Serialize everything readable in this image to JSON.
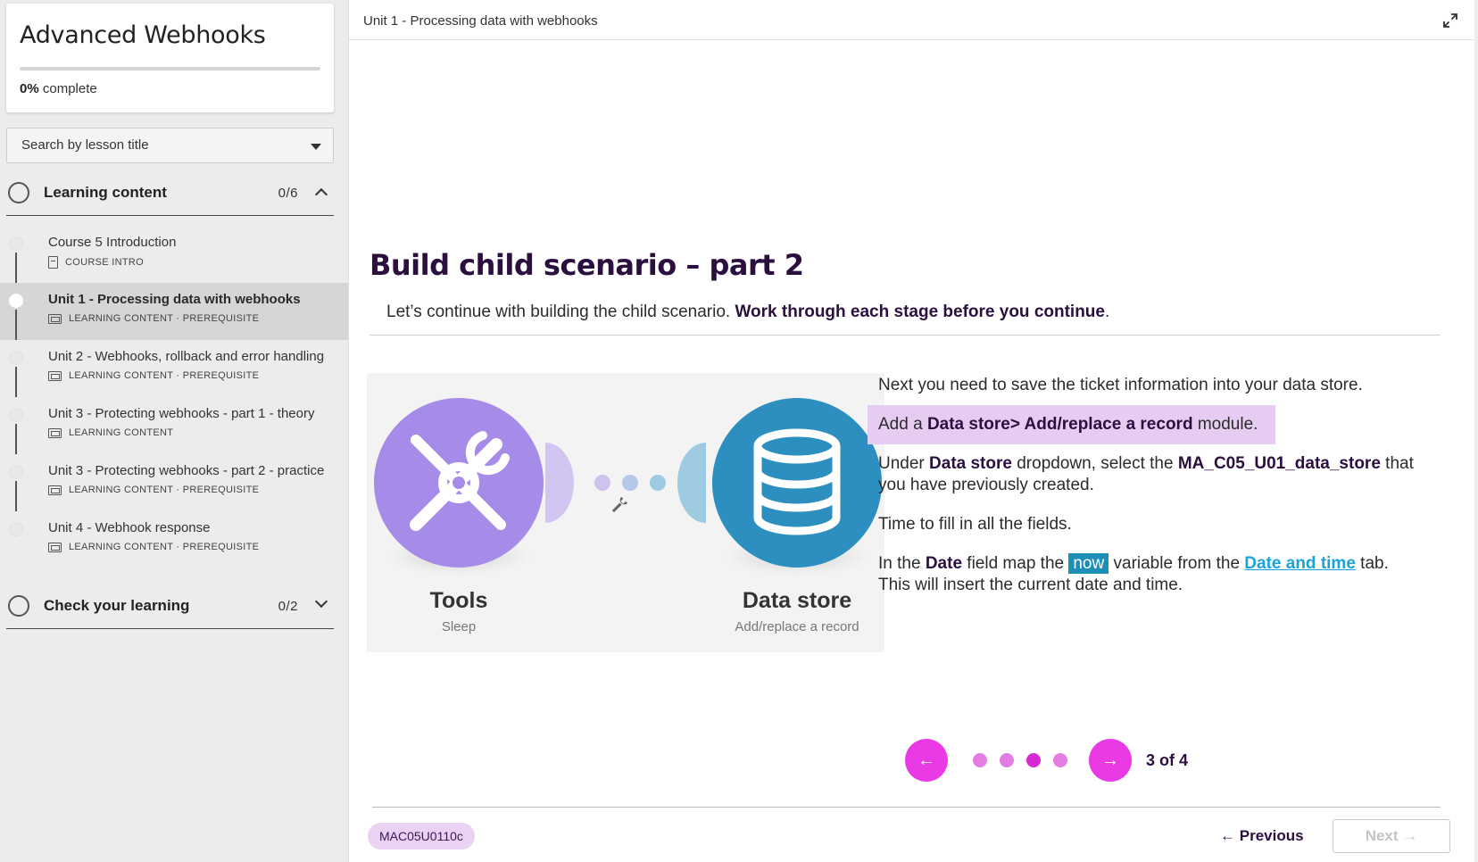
{
  "sidebar": {
    "course_title": "Advanced Webhooks",
    "progress_percent": "0%",
    "progress_suffix": "complete",
    "progress_value": 0,
    "search_placeholder": "Search by lesson title",
    "sections": [
      {
        "label": "Learning content",
        "count": "0/6"
      },
      {
        "label": "Check your learning",
        "count": "0/2"
      }
    ],
    "lessons": [
      {
        "title": "Course 5 Introduction",
        "meta": "COURSE INTRO"
      },
      {
        "title": "Unit 1 - Processing data with webhooks",
        "meta": "LEARNING CONTENT · PREREQUISITE"
      },
      {
        "title": "Unit 2 - Webhooks, rollback and error handling",
        "meta": "LEARNING CONTENT · PREREQUISITE"
      },
      {
        "title": "Unit 3 - Protecting webhooks - part 1 - theory",
        "meta": "LEARNING CONTENT"
      },
      {
        "title": "Unit 3 - Protecting webhooks - part 2 - practice",
        "meta": "LEARNING CONTENT · PREREQUISITE"
      },
      {
        "title": "Unit 4 - Webhook response",
        "meta": "LEARNING CONTENT · PREREQUISITE"
      }
    ]
  },
  "main": {
    "breadcrumb": "Unit 1 - Processing data with webhooks",
    "title": "Build child scenario – part 2",
    "lead_plain": "Let’s continue with building the child scenario. ",
    "lead_bold": "Work through each stage before you continue",
    "lead_end": ".",
    "scenario": {
      "module1_name": "Tools",
      "module1_sub": "Sleep",
      "module2_name": "Data store",
      "module2_sub": "Add/replace a record"
    },
    "steps": {
      "s1": "Next you need to save the ticket information into your data store.",
      "s2_a": "Add a ",
      "s2_b": "Data store> Add/replace a record",
      "s2_c": " module.",
      "s3_a": "Under ",
      "s3_b": "Data store",
      "s3_c": " dropdown, select the ",
      "s3_d": "MA_C05_U01_data_store",
      "s3_e": " that you have previously created.",
      "s4": "Time to fill in all the fields.",
      "s5_a": "In the ",
      "s5_b": "Date",
      "s5_c": " field map the ",
      "s5_now": "now",
      "s5_d": " variable from the ",
      "s5_link": "Date and time",
      "s5_e": " tab. This will insert the current date and time."
    },
    "pager": {
      "text": "3 of 4",
      "current": 3,
      "total": 4
    },
    "code": "MAC05U0110c",
    "prev_label": "Previous",
    "next_label": "Next"
  },
  "colors": {
    "accent": "#e93ae6",
    "title": "#2a0f3f",
    "tools_module": "#a78be8",
    "datastore_module": "#2d8fbf",
    "highlight": "#e5ccf0"
  }
}
